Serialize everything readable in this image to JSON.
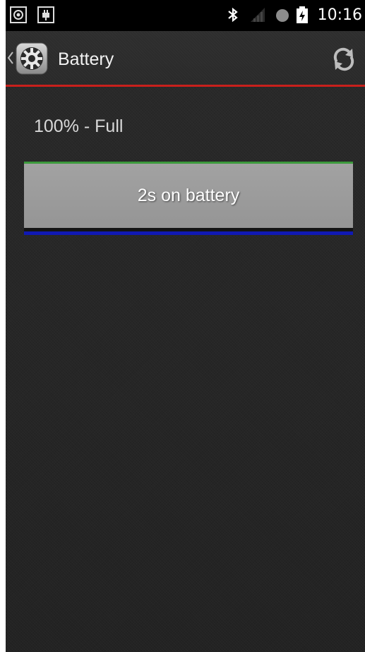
{
  "status_bar": {
    "time": "10:16",
    "icons": [
      "gps-icon",
      "usb-icon",
      "bluetooth-icon",
      "signal-icon",
      "sync-dot-icon",
      "battery-charging-icon"
    ]
  },
  "action_bar": {
    "title": "Battery",
    "app_icon": "settings-gear-icon",
    "back_icon": "chevron-left-icon",
    "refresh_icon": "refresh-icon",
    "divider_color": "#c8201c"
  },
  "battery": {
    "status_text": "100% - Full",
    "bar_label": "2s on battery",
    "level_percent": 100,
    "colors": {
      "top_line": "#3c9a3c",
      "fill": "#9b9b9b",
      "bottom_line": "#1019b4"
    }
  }
}
